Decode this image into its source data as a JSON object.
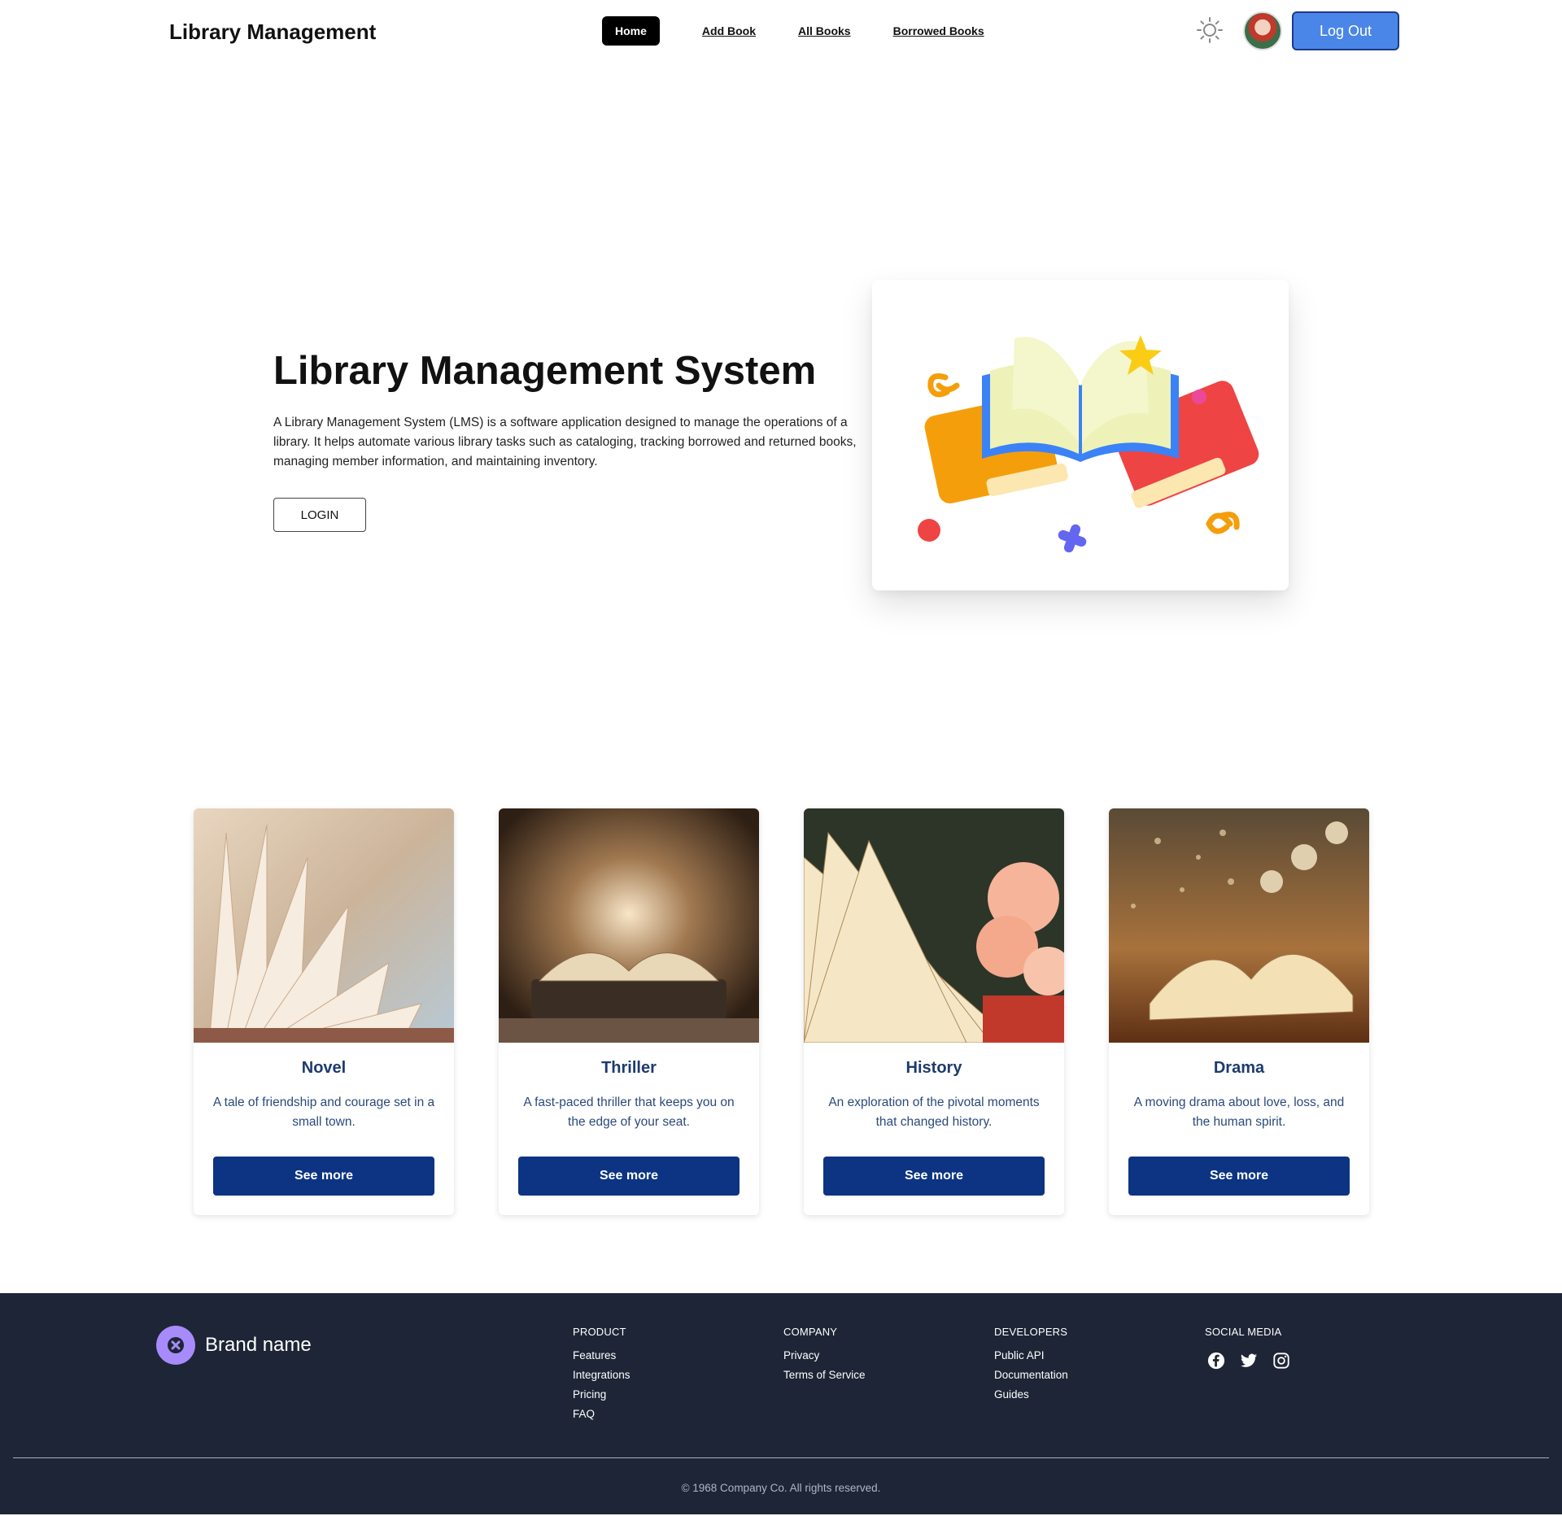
{
  "navbar": {
    "brand": "Library Management",
    "links": [
      {
        "label": "Home",
        "active": true
      },
      {
        "label": "Add Book"
      },
      {
        "label": "All Books"
      },
      {
        "label": "Borrowed Books"
      }
    ],
    "theme_icon": "sun-icon",
    "logout_label": "Log Out"
  },
  "hero": {
    "title": "Library Management System",
    "description": "A Library Management System (LMS) is a software application designed to manage the operations of a library. It helps automate various library tasks such as cataloging, tracking borrowed and returned books, managing member information, and maintaining inventory.",
    "login_label": "LOGIN"
  },
  "genres": [
    {
      "title": "Novel",
      "description": "A tale of friendship and courage set in a small town.",
      "button": "See more"
    },
    {
      "title": "Thriller",
      "description": "A fast-paced thriller that keeps you on the edge of your seat.",
      "button": "See more"
    },
    {
      "title": "History",
      "description": "An exploration of the pivotal moments that changed history.",
      "button": "See more"
    },
    {
      "title": "Drama",
      "description": "A moving drama about love, loss, and the human spirit.",
      "button": "See more"
    }
  ],
  "footer": {
    "brand_name": "Brand name",
    "columns": [
      {
        "title": "PRODUCT",
        "links": [
          "Features",
          "Integrations",
          "Pricing",
          "FAQ"
        ]
      },
      {
        "title": "COMPANY",
        "links": [
          "Privacy",
          "Terms of Service"
        ]
      },
      {
        "title": "DEVELOPERS",
        "links": [
          "Public API",
          "Documentation",
          "Guides"
        ]
      },
      {
        "title": "SOCIAL MEDIA",
        "icons": [
          "facebook-icon",
          "twitter-icon",
          "instagram-icon"
        ]
      }
    ],
    "copyright": "© 1968 Company Co. All rights reserved."
  },
  "colors": {
    "logout": "#4a86e8",
    "genre_button": "#0c3483",
    "footer_bg": "#1e2536",
    "brand_icon": "#a78bfa"
  }
}
